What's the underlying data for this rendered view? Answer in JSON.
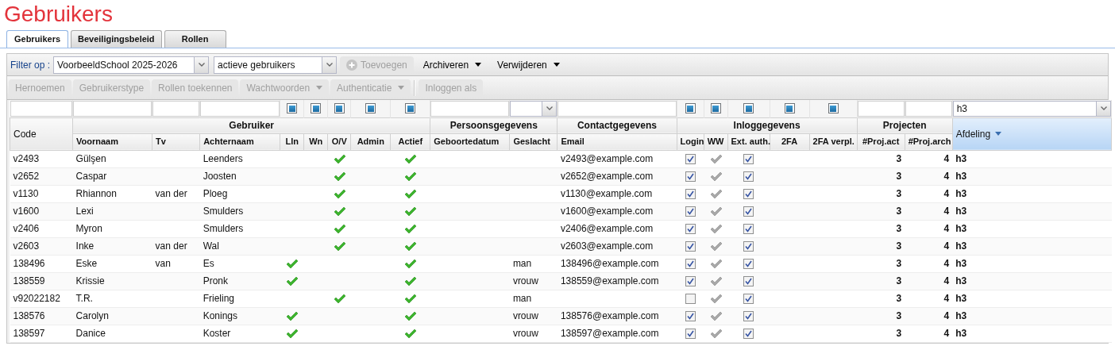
{
  "title": "Gebruikers",
  "tabs": [
    {
      "label": "Gebruikers",
      "selected": true
    },
    {
      "label": "Beveiligingsbeleid",
      "selected": false
    },
    {
      "label": "Rollen",
      "selected": false
    }
  ],
  "toolbar": {
    "filter_label": "Filter op :",
    "school": "VoorbeeldSchool 2025-2026",
    "status": "actieve gebruikers",
    "buttons": [
      {
        "label": "Toevoegen",
        "kind": "add",
        "disabled": true
      },
      {
        "label": "Archiveren",
        "kind": "menu",
        "disabled": false
      },
      {
        "label": "Verwijderen",
        "kind": "menu",
        "disabled": false
      }
    ]
  },
  "actions": [
    {
      "label": "Hernoemen",
      "kind": "button",
      "disabled": true
    },
    {
      "label": "Gebruikerstype",
      "kind": "button",
      "disabled": true
    },
    {
      "label": "Rollen toekennen",
      "kind": "button",
      "disabled": true
    },
    {
      "label": "Wachtwoorden",
      "kind": "menu",
      "disabled": true
    },
    {
      "label": "Authenticatie",
      "kind": "menu",
      "disabled": true
    },
    {
      "label": "Inloggen als",
      "kind": "button",
      "disabled": true
    }
  ],
  "filters": [
    {
      "kind": "text"
    },
    {
      "kind": "text"
    },
    {
      "kind": "text"
    },
    {
      "kind": "text"
    },
    {
      "kind": "tristate",
      "indeterminate": true
    },
    {
      "kind": "tristate",
      "indeterminate": true
    },
    {
      "kind": "tristate",
      "indeterminate": true
    },
    {
      "kind": "tristate",
      "indeterminate": true
    },
    {
      "kind": "tristate",
      "indeterminate": true
    },
    {
      "kind": "text"
    },
    {
      "kind": "select"
    },
    {
      "kind": "text"
    },
    {
      "kind": "tristate",
      "indeterminate": true
    },
    {
      "kind": "tristate",
      "indeterminate": true
    },
    {
      "kind": "tristate",
      "indeterminate": true
    },
    {
      "kind": "tristate",
      "indeterminate": true
    },
    {
      "kind": "tristate",
      "indeterminate": true
    },
    {
      "kind": "text"
    },
    {
      "kind": "text"
    },
    {
      "kind": "select",
      "value": "h3"
    }
  ],
  "header": [
    {
      "kind": "single",
      "label": "Code",
      "selected": false,
      "sorted": false
    },
    {
      "kind": "group",
      "label": "Gebruiker",
      "columns": [
        "Voornaam",
        "Tv",
        "Achternaam",
        "Lln",
        "Wn",
        "O/V",
        "Admin",
        "Actief"
      ]
    },
    {
      "kind": "group",
      "label": "Persoonsgegevens",
      "columns": [
        "Geboortedatum",
        "Geslacht"
      ]
    },
    {
      "kind": "group",
      "label": "Contactgegevens",
      "columns": [
        "Email"
      ]
    },
    {
      "kind": "group",
      "label": "Inloggegevens",
      "columns": [
        "Login",
        "WW",
        "Ext. auth.",
        "2FA",
        "2FA verpl."
      ]
    },
    {
      "kind": "group",
      "label": "Projecten",
      "columns": [
        "#Proj.act",
        "#Proj.arch"
      ]
    },
    {
      "kind": "single",
      "label": "Afdeling",
      "selected": true,
      "sorted": true
    }
  ],
  "rows": [
    {
      "code": "v2493",
      "first": "Gülşen",
      "tv": "",
      "last": "Leenders",
      "lln": false,
      "wn": false,
      "ov": true,
      "admin": false,
      "actief": true,
      "gender": "",
      "email": "v2493@example.com",
      "login": true,
      "ww": true,
      "ext": true,
      "act": "3",
      "arch": "4",
      "dept": "h3"
    },
    {
      "code": "v2652",
      "first": "Caspar",
      "tv": "",
      "last": "Joosten",
      "lln": false,
      "wn": false,
      "ov": true,
      "admin": false,
      "actief": true,
      "gender": "",
      "email": "v2652@example.com",
      "login": true,
      "ww": true,
      "ext": true,
      "act": "3",
      "arch": "4",
      "dept": "h3"
    },
    {
      "code": "v1130",
      "first": "Rhiannon",
      "tv": "van der",
      "last": "Ploeg",
      "lln": false,
      "wn": false,
      "ov": true,
      "admin": false,
      "actief": true,
      "gender": "",
      "email": "v1130@example.com",
      "login": true,
      "ww": true,
      "ext": true,
      "act": "3",
      "arch": "4",
      "dept": "h3"
    },
    {
      "code": "v1600",
      "first": "Lexi",
      "tv": "",
      "last": "Smulders",
      "lln": false,
      "wn": false,
      "ov": true,
      "admin": false,
      "actief": true,
      "gender": "",
      "email": "v1600@example.com",
      "login": true,
      "ww": true,
      "ext": true,
      "act": "3",
      "arch": "4",
      "dept": "h3"
    },
    {
      "code": "v2406",
      "first": "Myron",
      "tv": "",
      "last": "Smulders",
      "lln": false,
      "wn": false,
      "ov": true,
      "admin": false,
      "actief": true,
      "gender": "",
      "email": "v2406@example.com",
      "login": true,
      "ww": true,
      "ext": true,
      "act": "3",
      "arch": "4",
      "dept": "h3"
    },
    {
      "code": "v2603",
      "first": "Inke",
      "tv": "van der",
      "last": "Wal",
      "lln": false,
      "wn": false,
      "ov": true,
      "admin": false,
      "actief": true,
      "gender": "",
      "email": "v2603@example.com",
      "login": true,
      "ww": true,
      "ext": true,
      "act": "3",
      "arch": "4",
      "dept": "h3"
    },
    {
      "code": "138496",
      "first": "Eske",
      "tv": "van",
      "last": "Es",
      "lln": true,
      "wn": false,
      "ov": false,
      "admin": false,
      "actief": true,
      "gender": "man",
      "email": "138496@example.com",
      "login": true,
      "ww": true,
      "ext": true,
      "act": "3",
      "arch": "4",
      "dept": "h3"
    },
    {
      "code": "138559",
      "first": "Krissie",
      "tv": "",
      "last": "Pronk",
      "lln": true,
      "wn": false,
      "ov": false,
      "admin": false,
      "actief": true,
      "gender": "vrouw",
      "email": "138559@example.com",
      "login": true,
      "ww": true,
      "ext": true,
      "act": "3",
      "arch": "4",
      "dept": "h3"
    },
    {
      "code": "v92022182",
      "first": "T.R.",
      "tv": "",
      "last": "Frieling",
      "lln": false,
      "wn": false,
      "ov": true,
      "admin": false,
      "actief": true,
      "gender": "man",
      "email": "",
      "login": false,
      "ww": true,
      "ext": true,
      "act": "3",
      "arch": "4",
      "dept": "h3"
    },
    {
      "code": "138576",
      "first": "Carolyn",
      "tv": "",
      "last": "Konings",
      "lln": true,
      "wn": false,
      "ov": false,
      "admin": false,
      "actief": true,
      "gender": "vrouw",
      "email": "138576@example.com",
      "login": true,
      "ww": true,
      "ext": true,
      "act": "3",
      "arch": "4",
      "dept": "h3"
    },
    {
      "code": "138597",
      "first": "Danice",
      "tv": "",
      "last": "Koster",
      "lln": true,
      "wn": false,
      "ov": false,
      "admin": false,
      "actief": true,
      "gender": "vrouw",
      "email": "138597@example.com",
      "login": true,
      "ww": true,
      "ext": true,
      "act": "3",
      "arch": "4",
      "dept": "h3"
    }
  ]
}
